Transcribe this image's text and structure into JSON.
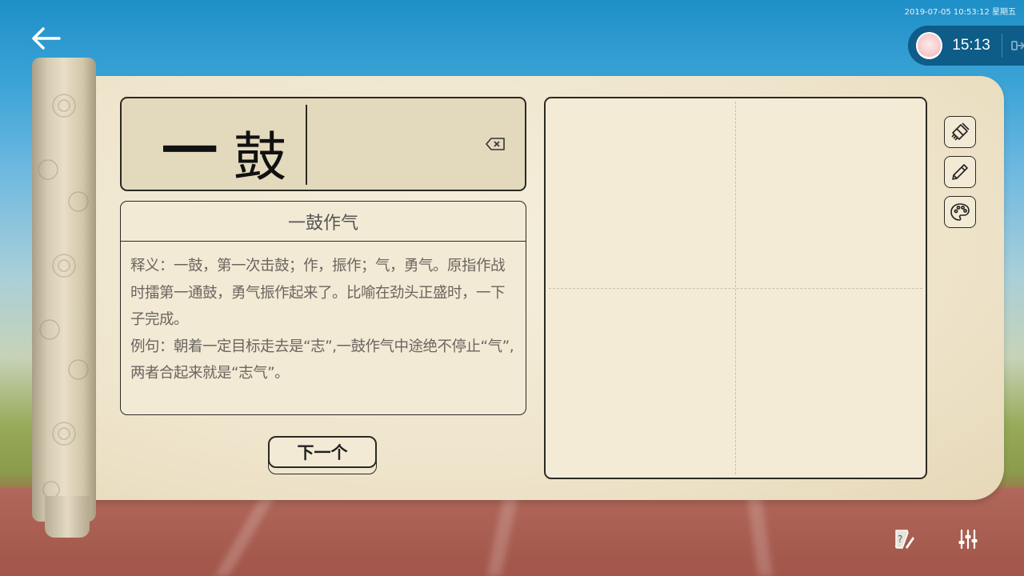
{
  "status_bar": {
    "timestamp": "2019-07-05 10:53:12 星期五"
  },
  "timer": {
    "time": "15:13"
  },
  "input": {
    "char_1": "一",
    "char_2": "鼓"
  },
  "idiom": {
    "title": "一鼓作气",
    "meaning": "释义：一鼓，第一次击鼓；作，振作；气，勇气。原指作战时擂第一通鼓，勇气振作起来了。比喻在劲头正盛时，一下子完成。",
    "example": "例句：朝着一定目标走去是“志”,一鼓作气中途绝不停止“气”,两者合起来就是“志气”。"
  },
  "buttons": {
    "next_label": "下一个"
  },
  "icons": {
    "back": "arrow-left-icon",
    "exit": "exit-icon",
    "delete": "backspace-icon",
    "eraser": "eraser-icon",
    "pencil": "pencil-icon",
    "palette": "palette-icon",
    "help": "help-pen-icon",
    "settings": "sliders-icon"
  },
  "colors": {
    "border": "#2b2a22",
    "paper": "#f3ead5",
    "pill": "#0e5c88"
  }
}
